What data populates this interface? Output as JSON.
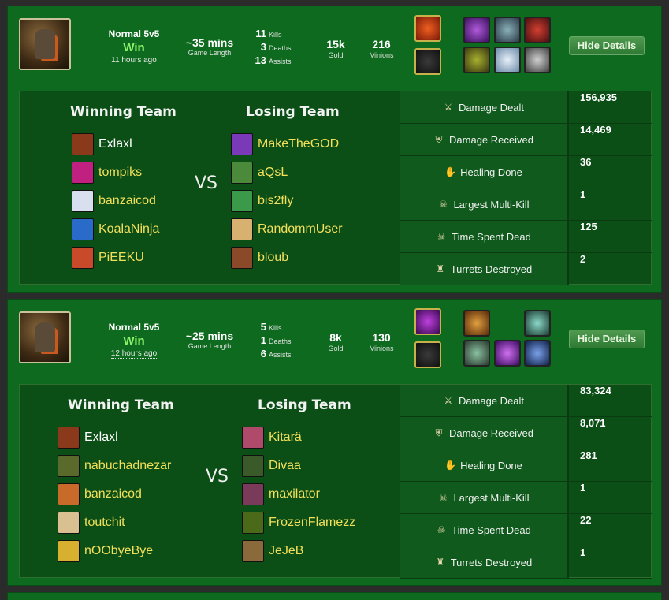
{
  "matches": [
    {
      "mode": "Normal 5v5",
      "result": "Win",
      "time_ago": "11 hours ago",
      "game_length": "~35 mins",
      "game_length_label": "Game Length",
      "kills": "11",
      "kills_label": "Kills",
      "deaths": "3",
      "deaths_label": "Deaths",
      "assists": "13",
      "assists_label": "Assists",
      "gold": "15k",
      "gold_label": "Gold",
      "minions": "216",
      "minions_label": "Minions",
      "hide_label": "Hide Details",
      "winning_label": "Winning Team",
      "losing_label": "Losing Team",
      "vs": "VS",
      "winning": [
        "Exlaxl",
        "tompiks",
        "banzaicod",
        "KoalaNinja",
        "PiEEKU"
      ],
      "losing": [
        "MakeTheGOD",
        "aQsL",
        "bis2fly",
        "RandommUser",
        "bloub"
      ],
      "stats": [
        {
          "label": "Damage Dealt",
          "value": "156,935"
        },
        {
          "label": "Damage Received",
          "value": "14,469"
        },
        {
          "label": "Healing Done",
          "value": "36"
        },
        {
          "label": "Largest Multi-Kill",
          "value": "1"
        },
        {
          "label": "Time Spent Dead",
          "value": "125"
        },
        {
          "label": "Turrets Destroyed",
          "value": "2"
        }
      ]
    },
    {
      "mode": "Normal 5v5",
      "result": "Win",
      "time_ago": "12 hours ago",
      "game_length": "~25 mins",
      "game_length_label": "Game Length",
      "kills": "5",
      "kills_label": "Kills",
      "deaths": "1",
      "deaths_label": "Deaths",
      "assists": "6",
      "assists_label": "Assists",
      "gold": "8k",
      "gold_label": "Gold",
      "minions": "130",
      "minions_label": "Minions",
      "hide_label": "Hide Details",
      "winning_label": "Winning Team",
      "losing_label": "Losing Team",
      "vs": "VS",
      "winning": [
        "Exlaxl",
        "nabuchadnezar",
        "banzaicod",
        "toutchit",
        "nOObyeBye"
      ],
      "losing": [
        "Kitarä",
        "Divaa",
        "maxilator",
        "FrozenFlamezz",
        "JeJeB"
      ],
      "stats": [
        {
          "label": "Damage Dealt",
          "value": "83,324"
        },
        {
          "label": "Damage Received",
          "value": "8,071"
        },
        {
          "label": "Healing Done",
          "value": "281"
        },
        {
          "label": "Largest Multi-Kill",
          "value": "1"
        },
        {
          "label": "Time Spent Dead",
          "value": "22"
        },
        {
          "label": "Turrets Destroyed",
          "value": "1"
        }
      ]
    }
  ],
  "stat_icons": [
    "sword-icon",
    "shield-icon",
    "hand-icon",
    "skulls-icon",
    "skull-icon",
    "turret-icon"
  ],
  "colors": {
    "panel": "#0d6a1e",
    "details": "#0b4e16",
    "win": "#8bf06a",
    "player_name": "#f3e05a"
  }
}
